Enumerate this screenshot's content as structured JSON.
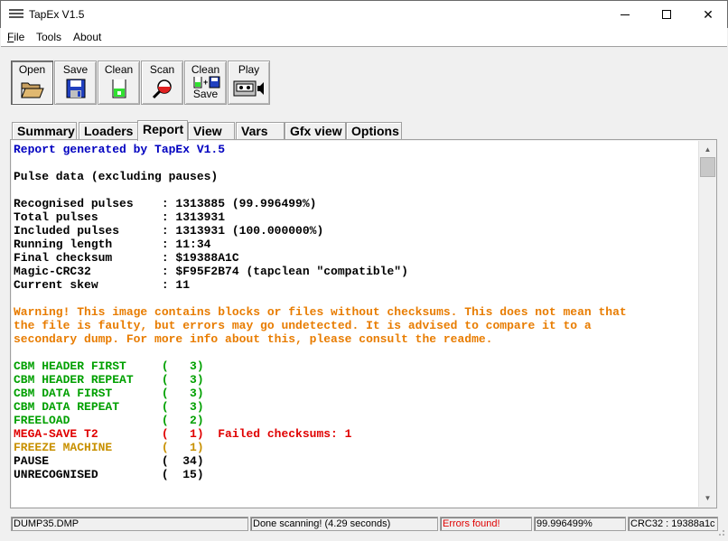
{
  "window": {
    "title": "TapEx V1.5",
    "minimize": "",
    "maximize": "",
    "close": "✕"
  },
  "menu": [
    {
      "label": "File",
      "accel": "F",
      "rest": "ile"
    },
    {
      "label": "Tools",
      "accel": "",
      "rest": "Tools"
    },
    {
      "label": "About",
      "accel": "",
      "rest": "About"
    }
  ],
  "toolbar": {
    "open": "Open",
    "save": "Save",
    "clean": "Clean",
    "scan": "Scan",
    "clean_save_top": "Clean",
    "clean_save_bottom": "Save",
    "play": "Play"
  },
  "tabs": [
    "Summary",
    "Loaders",
    "Report",
    "View",
    "Vars",
    "Gfx view",
    "Options"
  ],
  "active_tab": "Report",
  "report": {
    "lines": [
      {
        "text": "Report generated by TapEx V1.5",
        "color": "#0000c0"
      },
      {
        "text": "",
        "color": "#000000"
      },
      {
        "text": "Pulse data (excluding pauses)",
        "color": "#000000"
      },
      {
        "text": "",
        "color": "#000000"
      },
      {
        "text": "Recognised pulses    : 1313885 (99.996499%)",
        "color": "#000000"
      },
      {
        "text": "Total pulses         : 1313931",
        "color": "#000000"
      },
      {
        "text": "Included pulses      : 1313931 (100.000000%)",
        "color": "#000000"
      },
      {
        "text": "Running length       : 11:34",
        "color": "#000000"
      },
      {
        "text": "Final checksum       : $19388A1C",
        "color": "#000000"
      },
      {
        "text": "Magic-CRC32          : $F95F2B74 (tapclean \"compatible\")",
        "color": "#000000"
      },
      {
        "text": "Current skew         : 11",
        "color": "#000000"
      },
      {
        "text": "",
        "color": "#000000"
      },
      {
        "text": "Warning! This image contains blocks or files without checksums. This does not mean that",
        "color": "#e87c00"
      },
      {
        "text": "the file is faulty, but errors may go undetected. It is advised to compare it to a",
        "color": "#e87c00"
      },
      {
        "text": "secondary dump. For more info about this, please consult the readme.",
        "color": "#e87c00"
      },
      {
        "text": "",
        "color": "#000000"
      },
      {
        "text": "CBM HEADER FIRST     (   3)",
        "color": "#00a000"
      },
      {
        "text": "CBM HEADER REPEAT    (   3)",
        "color": "#00a000"
      },
      {
        "text": "CBM DATA FIRST       (   3)",
        "color": "#00a000"
      },
      {
        "text": "CBM DATA REPEAT      (   3)",
        "color": "#00a000"
      },
      {
        "text": "FREELOAD             (   2)",
        "color": "#00a000"
      },
      {
        "text": "MEGA-SAVE T2         (   1)  Failed checksums: 1",
        "color": "#e00000"
      },
      {
        "text": "FREEZE MACHINE       (   1)",
        "color": "#c89000"
      },
      {
        "text": "PAUSE                (  34)",
        "color": "#000000"
      },
      {
        "text": "UNRECOGNISED         (  15)",
        "color": "#000000"
      }
    ]
  },
  "scrollbar": {
    "up": "▲",
    "down": "▼"
  },
  "status": {
    "file": "DUMP35.DMP",
    "message": "Done scanning! (4.29 seconds)",
    "errors": "Errors found!",
    "errors_color": "#e00000",
    "percent": "99.996499%",
    "crc": "CRC32 : 19388a1c"
  }
}
